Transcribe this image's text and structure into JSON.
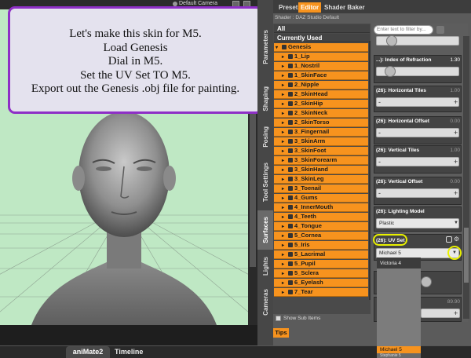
{
  "viewport": {
    "camera_label": "Default Camera"
  },
  "note": {
    "lines": [
      "Let's make this skin for M5.",
      "Load Genesis",
      "Dial in M5.",
      "Set the UV Set TO M5.",
      "Export out the Genesis .obj file for painting."
    ]
  },
  "bottom_tabs": {
    "animate": "aniMate2",
    "timeline": "Timeline"
  },
  "side_tabs": [
    "Parameters",
    "Shaping",
    "Posing",
    "Tool Settings",
    "Surfaces",
    "Lights",
    "Cameras"
  ],
  "panel": {
    "tabs": [
      "Presets",
      "Editor",
      "Shader Baker"
    ],
    "shader_label": "Shader : DAZ Studio Default",
    "list_headers": [
      "All",
      "Currently Used"
    ],
    "root_item": "Genesis",
    "items": [
      "1_Lip",
      "1_Nostril",
      "1_SkinFace",
      "2_Nipple",
      "2_SkinHead",
      "2_SkinHip",
      "2_SkinNeck",
      "2_SkinTorso",
      "3_Fingernail",
      "3_SkinArm",
      "3_SkinFoot",
      "3_SkinForearm",
      "3_SkinHand",
      "3_SkinLeg",
      "3_Toenail",
      "4_Gums",
      "4_InnerMouth",
      "4_Teeth",
      "4_Tongue",
      "5_Cornea",
      "5_Iris",
      "5_Lacrimal",
      "5_Pupil",
      "5_Sclera",
      "6_Eyelash",
      "7_Tear"
    ],
    "show_sub_items": "Show Sub Items",
    "tips": "Tips",
    "filter_placeholder": "Enter text to filter by..."
  },
  "properties": [
    {
      "title": "...): Index of Refraction",
      "value": "1.30"
    },
    {
      "title": "(26): Horizontal Tiles",
      "value": "1.00"
    },
    {
      "title": "(26): Horizontal Offset",
      "value": "0.00"
    },
    {
      "title": "(26): Vertical Tiles",
      "value": "1.00"
    },
    {
      "title": "(26): Vertical Offset",
      "value": "0.00"
    }
  ],
  "lighting_model": {
    "title": "(26): Lighting Model",
    "value": "Plastic"
  },
  "uv_set": {
    "title": "(26): UV Set",
    "value": "Michael 5"
  },
  "partial_value": "89.90",
  "uv_dropdown": {
    "options": [
      "Victoria 4",
      "Michael 5",
      "Stephanie 5"
    ],
    "selected": "Michael 5"
  },
  "colors": {
    "accent": "#f7931e",
    "note_border": "#8e2fc6",
    "highlight": "#e8f000",
    "viewport_bg": "#bfe8c4"
  }
}
